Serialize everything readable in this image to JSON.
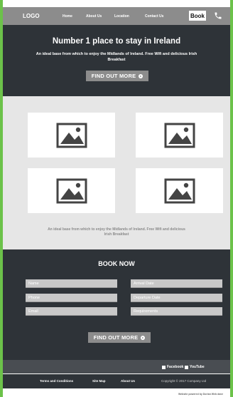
{
  "nav": {
    "logo": "LOGO",
    "links": [
      "Home",
      "About Us",
      "Location",
      "Contact Us"
    ],
    "book_label": "Book",
    "phone_icon": "phone-icon"
  },
  "hero": {
    "title": "Number 1 place to stay in Ireland",
    "subtitle": "An ideal base from which to enjoy the Midlands of Ireland. Free Wifi and delicious Irish Breakfast",
    "button_label": "FIND OUT MORE"
  },
  "gallery": {
    "image_icon": "image-placeholder-icon",
    "caption": "An ideal base from which to enjoy the Midlands of Ireland. Free Wifi and delicious Irish Breakfast"
  },
  "booking": {
    "title": "BOOK NOW",
    "left_fields": [
      "Name",
      "Phone",
      "Email"
    ],
    "right_fields": [
      "Arrival Date",
      "Departure Date",
      "Requirements"
    ],
    "button_label": "FIND OUT MORE"
  },
  "footer": {
    "social": [
      "Facebook",
      "YouTube"
    ],
    "links": [
      "Terms and Conditions",
      "Site Map",
      "About Us"
    ],
    "copyright": "Copyright © 2017 Company Ltd",
    "powered": "Website powered by Dorian Web dave"
  },
  "colors": {
    "accent_border": "#6cc24a",
    "dark": "#2e3338",
    "gray": "#8c8c8c",
    "light": "#e6e6e6"
  }
}
